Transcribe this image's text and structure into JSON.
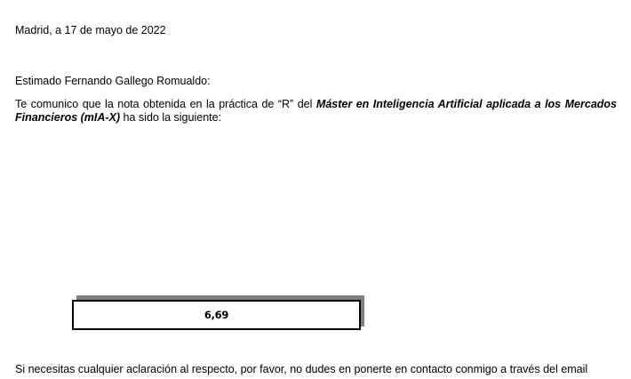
{
  "letter": {
    "date_line": "Madrid, a 17 de mayo de 2022",
    "greeting": "Estimado Fernando Gallego Romualdo:",
    "intro": "Te comunico que la nota obtenida en la práctica de “R” del ",
    "program_name": "Máster en Inteligencia Artificial aplicada a los Mercados Financieros (mIA-X)",
    "intro_end": " ha sido la siguiente:",
    "grade": "6,69",
    "closing": "Si necesitas cualquier aclaración al respecto, por favor, no dudes en ponerte en contacto conmigo a través del email"
  }
}
